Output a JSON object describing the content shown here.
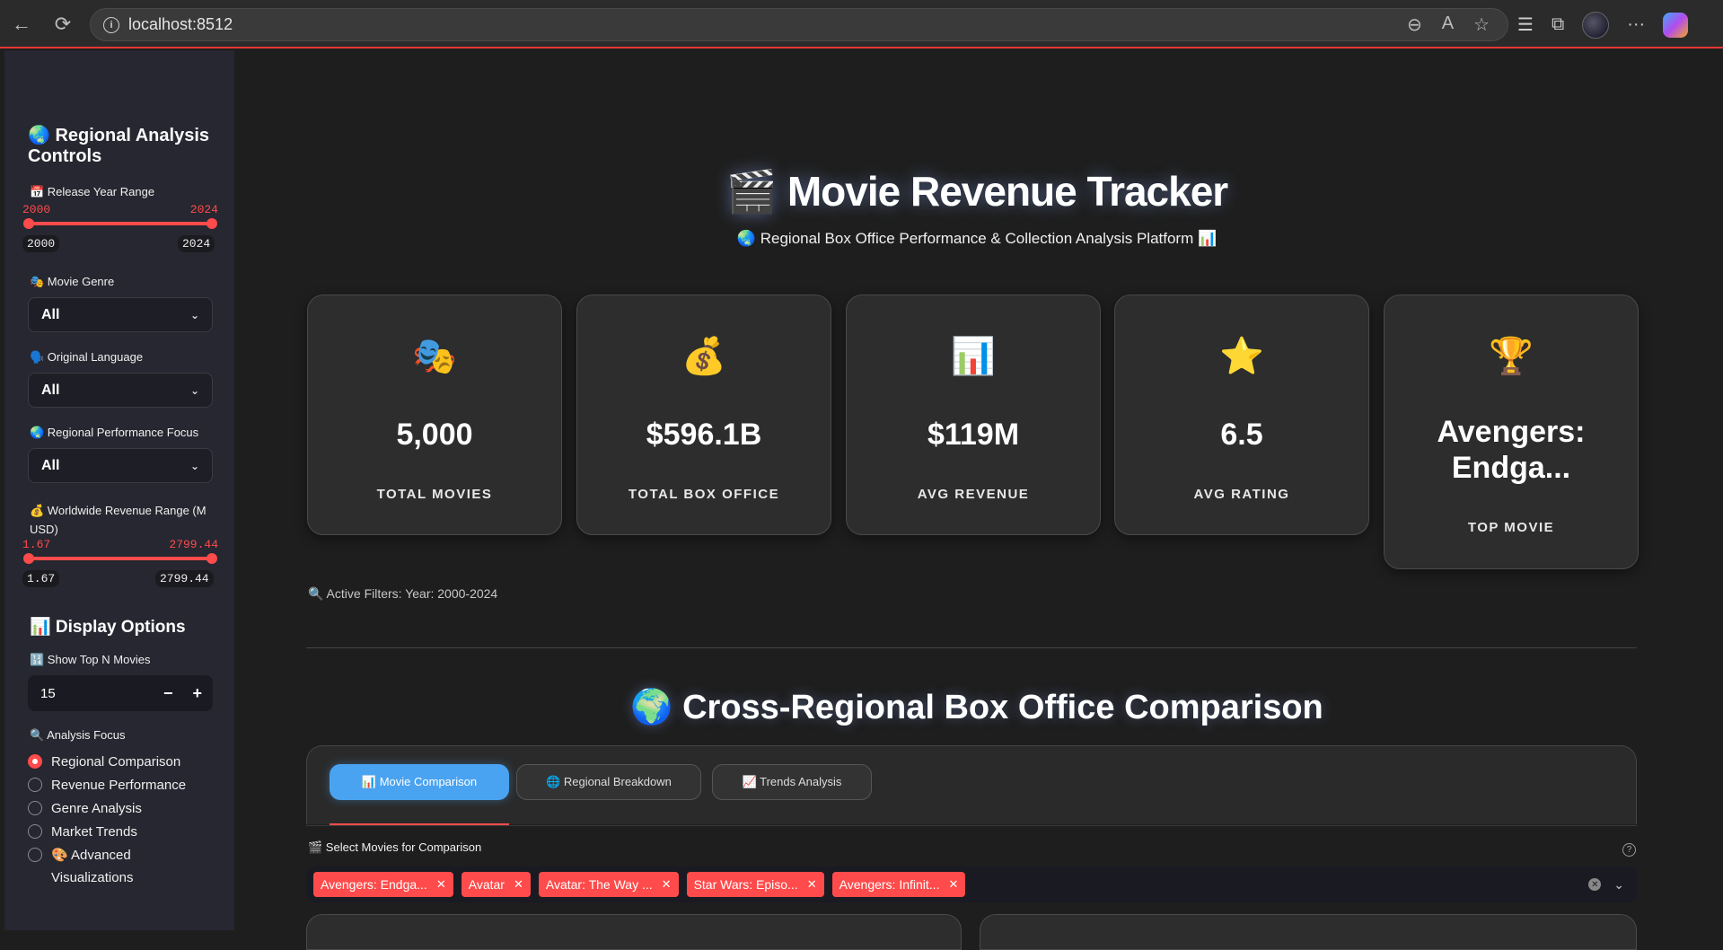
{
  "browser": {
    "url": "localhost:8512",
    "back_icon": "←",
    "reload_icon": "⟳",
    "more_icon": "···"
  },
  "sidebar": {
    "title": "🌏 Regional Analysis Controls",
    "release_year": {
      "label": "📅 Release Year Range",
      "min": "2000",
      "max": "2024",
      "low": "2000",
      "high": "2024"
    },
    "genre": {
      "label": "🎭 Movie Genre",
      "value": "All"
    },
    "language": {
      "label": "🗣️ Original Language",
      "value": "All"
    },
    "regional": {
      "label": "🌏 Regional Performance Focus",
      "value": "All"
    },
    "revenue": {
      "label": "💰 Worldwide Revenue Range (M USD)",
      "min": "1.67",
      "max": "2799.44",
      "low": "1.67",
      "high": "2799.44"
    },
    "display_title": "📊 Display Options",
    "top_n": {
      "label": "🔢 Show Top N Movies",
      "value": "15",
      "minus": "−",
      "plus": "+"
    },
    "analysis": {
      "label": "🔍 Analysis Focus",
      "options": [
        "Regional Comparison",
        "Revenue Performance",
        "Genre Analysis",
        "Market Trends",
        "🎨 Advanced Visualizations"
      ],
      "selected": "Regional Comparison"
    }
  },
  "main": {
    "title": "🎬 Movie Revenue Tracker",
    "subtitle": "🌏 Regional Box Office Performance & Collection Analysis Platform 📊",
    "metrics": [
      {
        "icon": "🎭",
        "value": "5,000",
        "label": "TOTAL MOVIES"
      },
      {
        "icon": "💰",
        "value": "$596.1B",
        "label": "TOTAL BOX OFFICE"
      },
      {
        "icon": "📊",
        "value": "$119M",
        "label": "AVG REVENUE"
      },
      {
        "icon": "⭐",
        "value": "6.5",
        "label": "AVG RATING"
      },
      {
        "icon": "🏆",
        "value": "Avengers: Endga...",
        "label": "TOP MOVIE"
      }
    ],
    "active_filters": "🔍 Active Filters: Year: 2000-2024",
    "section_title": "🌍 Cross-Regional Box Office Comparison",
    "tabs": [
      "📊 Movie Comparison",
      "🌐 Regional Breakdown",
      "📈 Trends Analysis"
    ],
    "multiselect": {
      "label": "🎬 Select Movies for Comparison",
      "tags": [
        "Avengers: Endga...",
        "Avatar",
        "Avatar: The Way ...",
        "Star Wars: Episo...",
        "Avengers: Infinit..."
      ]
    }
  }
}
